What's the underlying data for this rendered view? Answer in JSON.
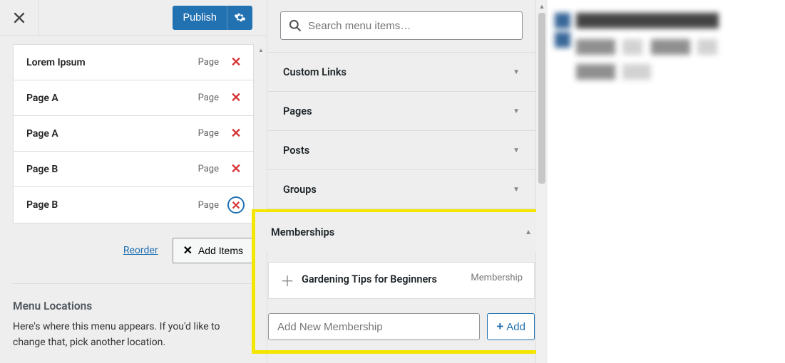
{
  "topbar": {
    "publish_label": "Publish"
  },
  "menu_items": [
    {
      "title": "Lorem Ipsum",
      "type": "Page",
      "circled": false
    },
    {
      "title": "Page A",
      "type": "Page",
      "circled": false
    },
    {
      "title": "Page A",
      "type": "Page",
      "circled": false
    },
    {
      "title": "Page B",
      "type": "Page",
      "circled": false
    },
    {
      "title": "Page B",
      "type": "Page",
      "circled": true
    }
  ],
  "left": {
    "reorder_label": "Reorder",
    "add_items_label": "Add Items",
    "menu_locations_title": "Menu Locations",
    "menu_locations_desc": "Here's where this menu appears. If you'd like to change that, pick another location."
  },
  "search": {
    "placeholder": "Search menu items…"
  },
  "categories": [
    {
      "label": "Custom Links"
    },
    {
      "label": "Pages"
    },
    {
      "label": "Posts"
    },
    {
      "label": "Groups"
    }
  ],
  "memberships": {
    "header": "Memberships",
    "item_name": "Gardening Tips for Beginners",
    "item_tag": "Membership",
    "add_placeholder": "Add New Membership",
    "add_button": "Add"
  }
}
